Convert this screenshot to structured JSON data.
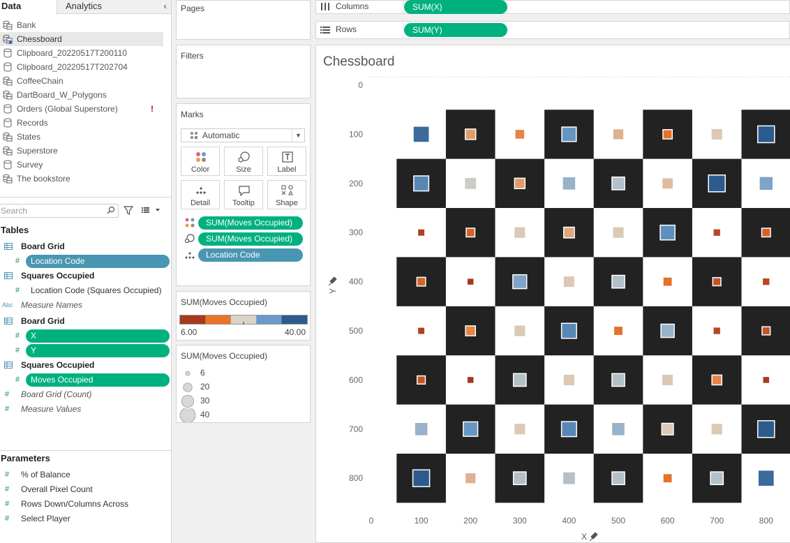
{
  "panel_tabs": {
    "data": "Data",
    "analytics": "Analytics"
  },
  "datasources": [
    {
      "name": "Bank",
      "icon": "multi-db-icon",
      "selected": false,
      "warning": false
    },
    {
      "name": "Chessboard",
      "icon": "multi-db-icon",
      "selected": true,
      "warning": false
    },
    {
      "name": "Clipboard_20220517T200110",
      "icon": "db-icon",
      "selected": false,
      "warning": false
    },
    {
      "name": "Clipboard_20220517T202704",
      "icon": "db-icon",
      "selected": false,
      "warning": false
    },
    {
      "name": "CoffeeChain",
      "icon": "multi-db-icon",
      "selected": false,
      "warning": false
    },
    {
      "name": "DartBoard_W_Polygons",
      "icon": "multi-db-icon",
      "selected": false,
      "warning": false
    },
    {
      "name": "Orders (Global Superstore)",
      "icon": "db-icon",
      "selected": false,
      "warning": true
    },
    {
      "name": "Records",
      "icon": "db-icon",
      "selected": false,
      "warning": false
    },
    {
      "name": "States",
      "icon": "multi-db-icon",
      "selected": false,
      "warning": false
    },
    {
      "name": "Superstore",
      "icon": "multi-db-icon",
      "selected": false,
      "warning": false
    },
    {
      "name": "Survey",
      "icon": "db-icon",
      "selected": false,
      "warning": false
    },
    {
      "name": "The bookstore",
      "icon": "multi-db-icon",
      "selected": false,
      "warning": false
    }
  ],
  "warning_mark": "!",
  "search": {
    "placeholder": "Search"
  },
  "tables": {
    "header": "Tables",
    "board_grid_1": "Board Grid",
    "location_code": "Location Code",
    "squares_occupied_1": "Squares Occupied",
    "location_code_sq": "Location Code (Squares Occupied)",
    "measure_names": "Measure Names",
    "board_grid_2": "Board Grid",
    "x": "X",
    "y": "Y",
    "squares_occupied_2": "Squares Occupied",
    "moves_occupied": "Moves Occupied",
    "board_grid_count": "Board Grid (Count)",
    "measure_values": "Measure Values",
    "abc": "Abc",
    "hash": "#"
  },
  "parameters": {
    "header": "Parameters",
    "items": [
      "% of Balance",
      "Overall Pixel Count",
      "Rows Down/Columns Across",
      "Select Player"
    ]
  },
  "cards": {
    "pages": "Pages",
    "filters": "Filters",
    "marks": "Marks",
    "mark_type": "Automatic",
    "buttons": [
      "Color",
      "Size",
      "Label",
      "Detail",
      "Tooltip",
      "Shape"
    ],
    "pills": [
      "SUM(Moves Occupied)",
      "SUM(Moves Occupied)",
      "Location Code"
    ]
  },
  "color_legend": {
    "title": "SUM(Moves Occupied)",
    "min": "6.00",
    "max": "40.00",
    "colors": [
      "#a53a20",
      "#e8752a",
      "#d9d4c8",
      "#6a9ac7",
      "#2c5b8e"
    ]
  },
  "size_legend": {
    "title": "SUM(Moves Occupied)",
    "values": [
      "6",
      "20",
      "30",
      "40"
    ]
  },
  "shelves": {
    "columns_label": "Columns",
    "columns_pill": "SUM(X)",
    "rows_label": "Rows",
    "rows_pill": "SUM(Y)"
  },
  "view": {
    "title": "Chessboard"
  },
  "chart_data": {
    "type": "scatter",
    "title": "Chessboard",
    "xlabel": "X",
    "ylabel": "Y",
    "xlim": [
      0,
      850
    ],
    "ylim": [
      0,
      850
    ],
    "y_reversed": true,
    "x_ticks": [
      0,
      100,
      200,
      300,
      400,
      500,
      600,
      700,
      800
    ],
    "y_ticks": [
      0,
      100,
      200,
      300,
      400,
      500,
      600,
      700,
      800
    ],
    "board_dark_color": "#222222",
    "board_light_color": "#ffffff",
    "dark_cells": [
      [
        200,
        100
      ],
      [
        400,
        100
      ],
      [
        600,
        100
      ],
      [
        800,
        100
      ],
      [
        100,
        200
      ],
      [
        300,
        200
      ],
      [
        500,
        200
      ],
      [
        700,
        200
      ],
      [
        200,
        300
      ],
      [
        400,
        300
      ],
      [
        600,
        300
      ],
      [
        800,
        300
      ],
      [
        100,
        400
      ],
      [
        300,
        400
      ],
      [
        500,
        400
      ],
      [
        700,
        400
      ],
      [
        200,
        500
      ],
      [
        400,
        500
      ],
      [
        600,
        500
      ],
      [
        800,
        500
      ],
      [
        100,
        600
      ],
      [
        300,
        600
      ],
      [
        500,
        600
      ],
      [
        700,
        600
      ],
      [
        200,
        700
      ],
      [
        400,
        700
      ],
      [
        600,
        700
      ],
      [
        800,
        700
      ],
      [
        100,
        800
      ],
      [
        300,
        800
      ],
      [
        500,
        800
      ],
      [
        700,
        800
      ]
    ],
    "mark_measure": "SUM(Moves Occupied)",
    "marks": [
      {
        "x": 100,
        "y": 100,
        "value": 38
      },
      {
        "x": 200,
        "y": 100,
        "value": 18
      },
      {
        "x": 300,
        "y": 100,
        "value": 16
      },
      {
        "x": 400,
        "y": 100,
        "value": 32
      },
      {
        "x": 500,
        "y": 100,
        "value": 20
      },
      {
        "x": 600,
        "y": 100,
        "value": 14
      },
      {
        "x": 700,
        "y": 100,
        "value": 22
      },
      {
        "x": 800,
        "y": 100,
        "value": 40
      },
      {
        "x": 100,
        "y": 200,
        "value": 34
      },
      {
        "x": 200,
        "y": 200,
        "value": 24
      },
      {
        "x": 300,
        "y": 200,
        "value": 18
      },
      {
        "x": 400,
        "y": 200,
        "value": 28
      },
      {
        "x": 500,
        "y": 200,
        "value": 26
      },
      {
        "x": 600,
        "y": 200,
        "value": 21
      },
      {
        "x": 700,
        "y": 200,
        "value": 40
      },
      {
        "x": 800,
        "y": 200,
        "value": 30
      },
      {
        "x": 100,
        "y": 300,
        "value": 7
      },
      {
        "x": 200,
        "y": 300,
        "value": 12
      },
      {
        "x": 300,
        "y": 300,
        "value": 22
      },
      {
        "x": 400,
        "y": 300,
        "value": 19
      },
      {
        "x": 500,
        "y": 300,
        "value": 22
      },
      {
        "x": 600,
        "y": 300,
        "value": 33
      },
      {
        "x": 700,
        "y": 300,
        "value": 8
      },
      {
        "x": 800,
        "y": 300,
        "value": 12
      },
      {
        "x": 100,
        "y": 400,
        "value": 12
      },
      {
        "x": 200,
        "y": 400,
        "value": 6
      },
      {
        "x": 300,
        "y": 400,
        "value": 30
      },
      {
        "x": 400,
        "y": 400,
        "value": 22
      },
      {
        "x": 500,
        "y": 400,
        "value": 26
      },
      {
        "x": 600,
        "y": 400,
        "value": 14
      },
      {
        "x": 700,
        "y": 400,
        "value": 10
      },
      {
        "x": 800,
        "y": 400,
        "value": 8
      },
      {
        "x": 100,
        "y": 500,
        "value": 7
      },
      {
        "x": 200,
        "y": 500,
        "value": 16
      },
      {
        "x": 300,
        "y": 500,
        "value": 22
      },
      {
        "x": 400,
        "y": 500,
        "value": 34
      },
      {
        "x": 500,
        "y": 500,
        "value": 14
      },
      {
        "x": 600,
        "y": 500,
        "value": 28
      },
      {
        "x": 700,
        "y": 500,
        "value": 8
      },
      {
        "x": 800,
        "y": 500,
        "value": 10
      },
      {
        "x": 100,
        "y": 600,
        "value": 10
      },
      {
        "x": 200,
        "y": 600,
        "value": 6
      },
      {
        "x": 300,
        "y": 600,
        "value": 26
      },
      {
        "x": 400,
        "y": 600,
        "value": 22
      },
      {
        "x": 500,
        "y": 600,
        "value": 26
      },
      {
        "x": 600,
        "y": 600,
        "value": 22
      },
      {
        "x": 700,
        "y": 600,
        "value": 16
      },
      {
        "x": 800,
        "y": 600,
        "value": 6
      },
      {
        "x": 100,
        "y": 700,
        "value": 28
      },
      {
        "x": 200,
        "y": 700,
        "value": 32
      },
      {
        "x": 300,
        "y": 700,
        "value": 22
      },
      {
        "x": 400,
        "y": 700,
        "value": 34
      },
      {
        "x": 500,
        "y": 700,
        "value": 28
      },
      {
        "x": 600,
        "y": 700,
        "value": 22
      },
      {
        "x": 700,
        "y": 700,
        "value": 22
      },
      {
        "x": 800,
        "y": 700,
        "value": 40
      },
      {
        "x": 100,
        "y": 800,
        "value": 40
      },
      {
        "x": 200,
        "y": 800,
        "value": 20
      },
      {
        "x": 300,
        "y": 800,
        "value": 26
      },
      {
        "x": 400,
        "y": 800,
        "value": 26
      },
      {
        "x": 500,
        "y": 800,
        "value": 26
      },
      {
        "x": 600,
        "y": 800,
        "value": 14
      },
      {
        "x": 700,
        "y": 800,
        "value": 26
      },
      {
        "x": 800,
        "y": 800,
        "value": 38
      }
    ],
    "color_scale": {
      "min": 6,
      "max": 40
    },
    "size_scale": {
      "min": 6,
      "max": 40
    }
  }
}
